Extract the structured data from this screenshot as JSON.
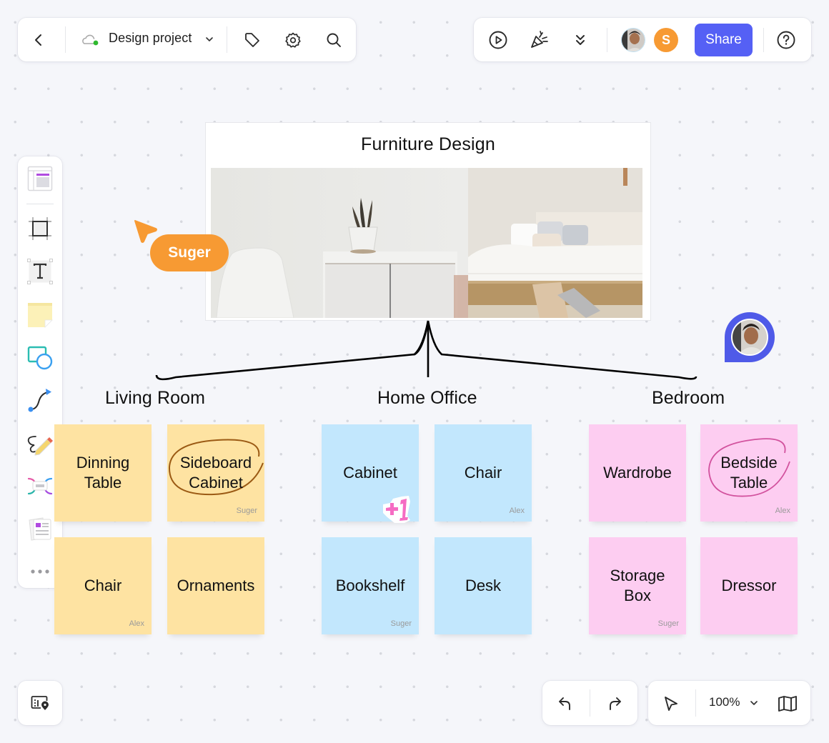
{
  "top_toolbar_left": {
    "back_icon": "chevron-left-icon",
    "cloud_status_icon": "cloud-synced-icon",
    "project_name": "Design project",
    "project_dropdown_icon": "chevron-down-icon",
    "tag_icon": "tag-icon",
    "settings_icon": "gear-icon",
    "search_icon": "search-icon"
  },
  "top_toolbar_right": {
    "present_icon": "play-circle-icon",
    "celebrate_icon": "party-popper-icon",
    "more_icon": "double-chevron-down-icon",
    "avatars": [
      {
        "type": "photo",
        "name": "Alex"
      },
      {
        "type": "initial",
        "initial": "S",
        "color": "#f79a33"
      }
    ],
    "share_label": "Share",
    "help_icon": "help-circle-icon"
  },
  "left_toolbar": {
    "tools": [
      {
        "name": "template",
        "icon": "template-icon"
      },
      {
        "name": "frame",
        "icon": "frame-icon"
      },
      {
        "name": "text",
        "icon": "text-icon"
      },
      {
        "name": "sticky-note",
        "icon": "sticky-note-icon"
      },
      {
        "name": "shape",
        "icon": "shape-icon"
      },
      {
        "name": "connector",
        "icon": "connector-icon"
      },
      {
        "name": "pen",
        "icon": "pen-icon"
      },
      {
        "name": "mind-map",
        "icon": "mind-map-icon"
      },
      {
        "name": "card",
        "icon": "card-icon"
      },
      {
        "name": "more",
        "icon": "more-horizontal-icon"
      }
    ]
  },
  "canvas": {
    "card_title": "Furniture Design",
    "cursors": [
      {
        "name": "Suger",
        "color": "#f79a33"
      }
    ],
    "sections": [
      {
        "title": "Living Room",
        "color": "#fee3a2",
        "notes": [
          {
            "text": "Dinning\nTable",
            "author": ""
          },
          {
            "text": "Sideboard\nCabinet",
            "author": "Suger",
            "circled": true
          },
          {
            "text": "Chair",
            "author": "Alex"
          },
          {
            "text": "Ornaments",
            "author": ""
          }
        ]
      },
      {
        "title": "Home Office",
        "color": "#c2e7fd",
        "notes": [
          {
            "text": "Cabinet",
            "author": "",
            "sticker": "+1"
          },
          {
            "text": "Chair",
            "author": "Alex"
          },
          {
            "text": "Bookshelf",
            "author": "Suger"
          },
          {
            "text": "Desk",
            "author": ""
          }
        ]
      },
      {
        "title": "Bedroom",
        "color": "#fdcdf1",
        "notes": [
          {
            "text": "Wardrobe",
            "author": ""
          },
          {
            "text": "Bedside\nTable",
            "author": "Alex",
            "circled": true
          },
          {
            "text": "Storage\nBox",
            "author": "Suger"
          },
          {
            "text": "Dressor",
            "author": ""
          }
        ]
      }
    ]
  },
  "bottom_left": {
    "icon": "board-outline-icon"
  },
  "bottom_right": {
    "undo_icon": "undo-icon",
    "redo_icon": "redo-icon",
    "select_icon": "pointer-icon",
    "zoom_level": "100%",
    "zoom_dropdown_icon": "chevron-down-icon",
    "minimap_icon": "map-icon"
  },
  "colors": {
    "accent": "#5560f5",
    "user_suger": "#f79a33",
    "user_alex_pin": "#4f5ae8"
  }
}
